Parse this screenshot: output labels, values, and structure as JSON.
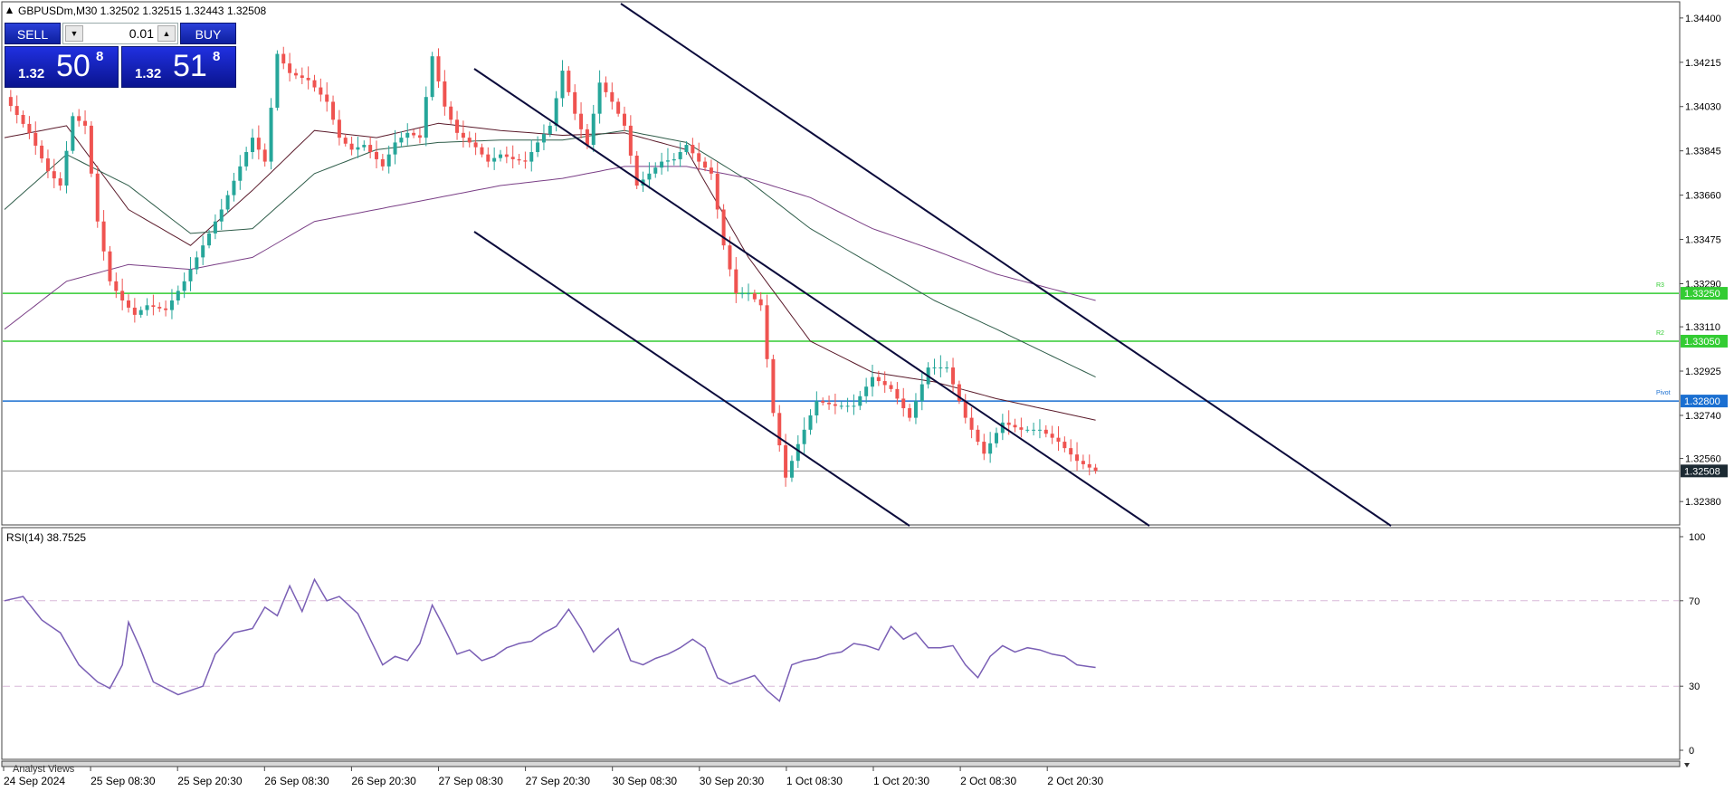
{
  "header": {
    "symbol_info": "GBPUSDm,M30  1.32502 1.32515 1.32443 1.32508"
  },
  "trade_panel": {
    "sell_label": "SELL",
    "buy_label": "BUY",
    "lot": "0.01",
    "sell_price_prefix": "1.32",
    "sell_price_big": "50",
    "sell_price_frac": "8",
    "buy_price_prefix": "1.32",
    "buy_price_big": "51",
    "buy_price_frac": "8"
  },
  "price_axis": {
    "ticks": [
      "1.34400",
      "1.34215",
      "1.34030",
      "1.33845",
      "1.33660",
      "1.33475",
      "1.33290",
      "1.33110",
      "1.32925",
      "1.32740",
      "1.32560",
      "1.32380"
    ]
  },
  "levels": [
    {
      "price": 1.3325,
      "label": "1.33250",
      "tag": "R3",
      "color": "#33cc33"
    },
    {
      "price": 1.3305,
      "label": "1.33050",
      "tag": "R2",
      "color": "#33cc33"
    },
    {
      "price": 1.328,
      "label": "1.32800",
      "tag": "Pivot",
      "color": "#1a6fd1"
    }
  ],
  "current_price": {
    "price": 1.32508,
    "label": "1.32508"
  },
  "rsi": {
    "title": "RSI(14) 38.7525",
    "axis_ticks": [
      "100",
      "70",
      "30",
      "0"
    ],
    "overbought": 70,
    "oversold": 30,
    "color": "#7a5fb5"
  },
  "time_axis": {
    "labels": [
      "24 Sep 2024",
      "25 Sep 08:30",
      "25 Sep 20:30",
      "26 Sep 08:30",
      "26 Sep 20:30",
      "27 Sep 08:30",
      "27 Sep 20:30",
      "30 Sep 08:30",
      "30 Sep 20:30",
      "1 Oct 08:30",
      "1 Oct 20:30",
      "2 Oct 08:30",
      "2 Oct 20:30"
    ]
  },
  "bottom_tab": "Analyst Views",
  "colors": {
    "bull": "#26a69a",
    "bear": "#ef5350",
    "channel": "#0b0b3b",
    "grid": "#dddddd"
  },
  "chart_data": {
    "type": "candlestick",
    "interval": "M30",
    "ylim": [
      1.3229,
      1.3446
    ],
    "close_points": [
      [
        0,
        1.3407
      ],
      [
        4,
        1.3392
      ],
      [
        7,
        1.3376
      ],
      [
        9,
        1.337
      ],
      [
        11,
        1.3399
      ],
      [
        13,
        1.3395
      ],
      [
        15,
        1.3355
      ],
      [
        17,
        1.333
      ],
      [
        19,
        1.3322
      ],
      [
        21,
        1.3316
      ],
      [
        23,
        1.332
      ],
      [
        26,
        1.3318
      ],
      [
        29,
        1.333
      ],
      [
        32,
        1.3345
      ],
      [
        35,
        1.336
      ],
      [
        38,
        1.3378
      ],
      [
        40,
        1.339
      ],
      [
        42,
        1.338
      ],
      [
        44,
        1.3425
      ],
      [
        46,
        1.3417
      ],
      [
        49,
        1.3414
      ],
      [
        52,
        1.3405
      ],
      [
        54,
        1.339
      ],
      [
        56,
        1.3385
      ],
      [
        58,
        1.3387
      ],
      [
        61,
        1.3378
      ],
      [
        63,
        1.3388
      ],
      [
        65,
        1.3392
      ],
      [
        67,
        1.339
      ],
      [
        69,
        1.3424
      ],
      [
        71,
        1.3403
      ],
      [
        73,
        1.3392
      ],
      [
        76,
        1.3386
      ],
      [
        78,
        1.338
      ],
      [
        80,
        1.3383
      ],
      [
        82,
        1.3381
      ],
      [
        84,
        1.338
      ],
      [
        86,
        1.3388
      ],
      [
        88,
        1.3395
      ],
      [
        90,
        1.3418
      ],
      [
        92,
        1.34
      ],
      [
        94,
        1.3387
      ],
      [
        96,
        1.3413
      ],
      [
        98,
        1.3405
      ],
      [
        100,
        1.3395
      ],
      [
        102,
        1.337
      ],
      [
        104,
        1.3375
      ],
      [
        106,
        1.338
      ],
      [
        108,
        1.3381
      ],
      [
        110,
        1.3387
      ],
      [
        112,
        1.338
      ],
      [
        114,
        1.3375
      ],
      [
        116,
        1.3345
      ],
      [
        118,
        1.3325
      ],
      [
        120,
        1.3325
      ],
      [
        122,
        1.332
      ],
      [
        124,
        1.3275
      ],
      [
        126,
        1.3248
      ],
      [
        128,
        1.3262
      ],
      [
        131,
        1.328
      ],
      [
        134,
        1.3278
      ],
      [
        137,
        1.3278
      ],
      [
        140,
        1.329
      ],
      [
        143,
        1.3285
      ],
      [
        146,
        1.3273
      ],
      [
        149,
        1.3294
      ],
      [
        152,
        1.3294
      ],
      [
        155,
        1.3273
      ],
      [
        158,
        1.3258
      ],
      [
        161,
        1.3271
      ],
      [
        164,
        1.3268
      ],
      [
        167,
        1.3268
      ],
      [
        170,
        1.3263
      ],
      [
        173,
        1.3255
      ],
      [
        176,
        1.32508
      ]
    ],
    "moving_averages": [
      {
        "period": 21,
        "points": [
          [
            0,
            1.339
          ],
          [
            10,
            1.3395
          ],
          [
            20,
            1.336
          ],
          [
            30,
            1.3345
          ],
          [
            40,
            1.3368
          ],
          [
            50,
            1.3393
          ],
          [
            60,
            1.339
          ],
          [
            70,
            1.3396
          ],
          [
            80,
            1.3393
          ],
          [
            90,
            1.3391
          ],
          [
            100,
            1.3392
          ],
          [
            110,
            1.3385
          ],
          [
            120,
            1.334
          ],
          [
            130,
            1.3305
          ],
          [
            140,
            1.3292
          ],
          [
            150,
            1.3288
          ],
          [
            160,
            1.3281
          ],
          [
            176,
            1.3272
          ]
        ]
      },
      {
        "period": 50,
        "points": [
          [
            0,
            1.336
          ],
          [
            10,
            1.3383
          ],
          [
            20,
            1.337
          ],
          [
            30,
            1.335
          ],
          [
            40,
            1.3352
          ],
          [
            50,
            1.3375
          ],
          [
            60,
            1.3385
          ],
          [
            70,
            1.3388
          ],
          [
            80,
            1.3389
          ],
          [
            90,
            1.3389
          ],
          [
            100,
            1.3393
          ],
          [
            110,
            1.3388
          ],
          [
            120,
            1.3372
          ],
          [
            130,
            1.3352
          ],
          [
            140,
            1.3337
          ],
          [
            150,
            1.3322
          ],
          [
            160,
            1.331
          ],
          [
            176,
            1.329
          ]
        ]
      },
      {
        "period": 200,
        "points": [
          [
            0,
            1.331
          ],
          [
            10,
            1.333
          ],
          [
            20,
            1.3337
          ],
          [
            30,
            1.3335
          ],
          [
            40,
            1.334
          ],
          [
            50,
            1.3355
          ],
          [
            60,
            1.336
          ],
          [
            70,
            1.3365
          ],
          [
            80,
            1.337
          ],
          [
            90,
            1.3373
          ],
          [
            100,
            1.3378
          ],
          [
            110,
            1.3378
          ],
          [
            120,
            1.3373
          ],
          [
            130,
            1.3365
          ],
          [
            140,
            1.3352
          ],
          [
            150,
            1.3343
          ],
          [
            160,
            1.3333
          ],
          [
            176,
            1.3322
          ]
        ]
      }
    ],
    "rsi_points": [
      [
        0,
        70
      ],
      [
        3,
        72
      ],
      [
        6,
        61
      ],
      [
        9,
        55
      ],
      [
        12,
        40
      ],
      [
        15,
        32
      ],
      [
        17,
        29
      ],
      [
        19,
        40
      ],
      [
        20,
        60
      ],
      [
        22,
        47
      ],
      [
        24,
        32
      ],
      [
        26,
        29
      ],
      [
        28,
        26
      ],
      [
        30,
        28
      ],
      [
        32,
        30
      ],
      [
        34,
        45
      ],
      [
        37,
        55
      ],
      [
        40,
        57
      ],
      [
        42,
        67
      ],
      [
        44,
        63
      ],
      [
        46,
        77
      ],
      [
        48,
        65
      ],
      [
        50,
        80
      ],
      [
        52,
        70
      ],
      [
        54,
        72
      ],
      [
        57,
        64
      ],
      [
        59,
        52
      ],
      [
        61,
        40
      ],
      [
        63,
        44
      ],
      [
        65,
        42
      ],
      [
        67,
        50
      ],
      [
        69,
        68
      ],
      [
        71,
        57
      ],
      [
        73,
        45
      ],
      [
        75,
        47
      ],
      [
        77,
        42
      ],
      [
        79,
        44
      ],
      [
        81,
        48
      ],
      [
        83,
        50
      ],
      [
        85,
        51
      ],
      [
        87,
        55
      ],
      [
        89,
        58
      ],
      [
        91,
        66
      ],
      [
        93,
        57
      ],
      [
        95,
        46
      ],
      [
        97,
        52
      ],
      [
        99,
        57
      ],
      [
        101,
        42
      ],
      [
        103,
        40
      ],
      [
        105,
        43
      ],
      [
        107,
        45
      ],
      [
        109,
        48
      ],
      [
        111,
        52
      ],
      [
        113,
        48
      ],
      [
        115,
        34
      ],
      [
        117,
        31
      ],
      [
        119,
        33
      ],
      [
        121,
        35
      ],
      [
        123,
        28
      ],
      [
        125,
        23
      ],
      [
        127,
        40
      ],
      [
        129,
        42
      ],
      [
        131,
        43
      ],
      [
        133,
        45
      ],
      [
        135,
        46
      ],
      [
        137,
        50
      ],
      [
        139,
        49
      ],
      [
        141,
        47
      ],
      [
        143,
        58
      ],
      [
        145,
        52
      ],
      [
        147,
        55
      ],
      [
        149,
        48
      ],
      [
        151,
        48
      ],
      [
        153,
        49
      ],
      [
        155,
        40
      ],
      [
        157,
        34
      ],
      [
        159,
        44
      ],
      [
        161,
        49
      ],
      [
        163,
        46
      ],
      [
        165,
        48
      ],
      [
        167,
        47
      ],
      [
        169,
        45
      ],
      [
        171,
        44
      ],
      [
        173,
        40
      ],
      [
        176,
        38.75
      ]
    ]
  }
}
